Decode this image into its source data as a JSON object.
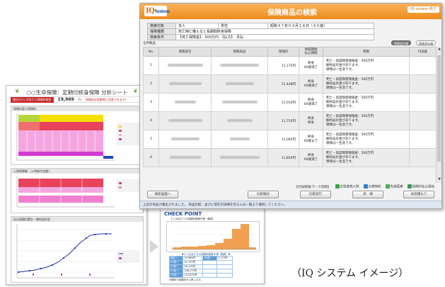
{
  "analysis_sheet": {
    "title": "○○生命保険：定期付終身保険 分析シート",
    "badge": "現在の1ヶ月あたり保険料負担",
    "amount": "19,969",
    "amount_unit": "円",
    "note": "保険料は変動時に見直されます！",
    "panel1": "保障内容と保険料",
    "panel2": "入院保障額 （入院給付金額）",
    "panel3": "払込保険料累計・解約返戻金"
  },
  "check_point": {
    "title": "CHECK POINT",
    "subtitle": "１ヶ月あたりの保険料推移予想（概算）",
    "caption": "▼１ヶ月あたりの保険料推移予想（概算）▼",
    "rows": [
      [
        "現在～",
        "19,969円",
        "60歳～",
        "7,170円"
      ],
      [
        "40歳～",
        "31,170円",
        "",
        ""
      ],
      [
        "45歳～",
        "16,170円",
        "",
        ""
      ],
      [
        "50歳～",
        "106,170円",
        "",
        ""
      ],
      [
        "55歳～",
        "222,870円",
        "",
        ""
      ]
    ],
    "note": "※更新で保険料が上昇します。"
  },
  "window": {
    "logo_main": "IQ",
    "logo_sub": "System",
    "title": "保険商品の検索",
    "system_button": "IQ system 終了",
    "conditions": {
      "row1": {
        "k": "検索対象",
        "v": "本人",
        "k2": "男性",
        "v2": "昭和４７年０４月１８日（４０歳）"
      },
      "row2": {
        "k": "保障種類",
        "v": "死亡時に備えると長期間終身保障"
      },
      "row3": {
        "k": "検索条件",
        "v": "【死亡保障金】：500万円　【払方】：月払"
      }
    },
    "list_label": "全件数品",
    "filters": [
      "保険会社順",
      "保険会社順"
    ],
    "columns": [
      "No.",
      "保険会社",
      "保険商品",
      "保険料",
      "保険期間\n払込期間",
      "特徴",
      "付加金"
    ],
    "rows": [
      {
        "no": "1",
        "premium": "11,175円",
        "period": "終身\n60歳満了",
        "feature": [
          "死亡・高度障害保険金：500万円",
          "解約返戻金があります。",
          "保障は一生涯です。"
        ]
      },
      {
        "no": "2",
        "premium": "11,448円",
        "period": "終身\n60歳満了",
        "feature": [
          "死亡・高度障害保険金：500万円",
          "解約返戻金があります。",
          "保障は一生涯です。"
        ]
      },
      {
        "no": "3",
        "premium": "11,550円",
        "period": "終身\n60歳満了",
        "feature": [
          "死亡・高度障害保険金：500万円",
          "解約返戻金があります。",
          "保障は一生涯です。"
        ]
      },
      {
        "no": "4",
        "premium": "11,755円",
        "period": "終身\n終身",
        "feature": [
          "死亡・高度障害保険金：500万円",
          "解約返戻金があります。",
          "保障は一生涯です。"
        ]
      },
      {
        "no": "5",
        "premium": "11,085円",
        "period": "終身\n60歳まで",
        "feature": [
          "死亡・高度障害保険金：500万円",
          "解約返戻金があります。",
          "保障は一生涯です。"
        ]
      },
      {
        "no": "6",
        "premium": "11,850円",
        "period": "終身\n60歳満了",
        "feature": [
          "死亡・高度障害保険金：500万円",
          "解約返戻金があります。",
          "保障は一生涯です。"
        ]
      }
    ],
    "legend": [
      "【付加保険/マーク説明】",
      "女性疾病入院",
      "災害特約",
      "先進医療",
      "保険料払込免除"
    ],
    "buttons": [
      "検索画面へ",
      "比較検討",
      "比較実行",
      "詳　細",
      "再見積もり"
    ],
    "status": "上記の商品が検出されました。 商品比較、並びに現在の詳細を見るには一覧より選択してください。"
  },
  "caption": "（IQ システム イメージ）"
}
